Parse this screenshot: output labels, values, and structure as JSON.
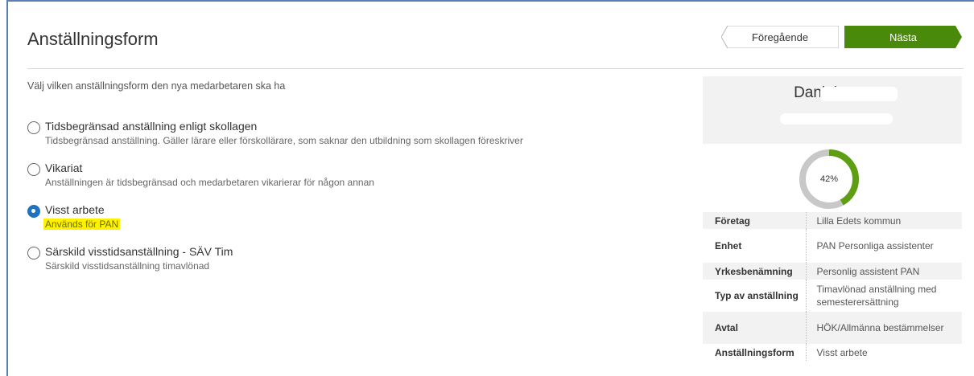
{
  "header": {
    "title": "Anställningsform",
    "prev_label": "Föregående",
    "next_label": "Nästa"
  },
  "instruction": "Välj vilken anställningsform den nya medarbetaren ska ha",
  "options": [
    {
      "title": "Tidsbegränsad anställning enligt skollagen",
      "desc": "Tidsbegränsad anställning. Gäller lärare eller förskollärare, som saknar den utbildning som skollagen föreskriver",
      "selected": false
    },
    {
      "title": "Vikariat",
      "desc": "Anställningen är tidsbegränsad och medarbetaren vikarierar för någon annan",
      "selected": false
    },
    {
      "title": "Visst arbete",
      "desc": "Används för PAN",
      "selected": true
    },
    {
      "title": "Särskild visstidsanställning - SÄV Tim",
      "desc": "Särskild visstidsanställning timavlönad",
      "selected": false
    }
  ],
  "panel": {
    "name": "Daniel",
    "progress_label": "42%",
    "progress_value": 0.42,
    "rows": [
      {
        "key": "Företag",
        "value": "Lilla Edets kommun"
      },
      {
        "key": "Enhet",
        "value": "PAN Personliga assistenter"
      },
      {
        "key": "Yrkesbenämning",
        "value": "Personlig assistent PAN"
      },
      {
        "key": "Typ av anställning",
        "value": "Timavlönad anställning med semesterersättning"
      },
      {
        "key": "Avtal",
        "value": "HÖK/Allmänna bestämmelser"
      },
      {
        "key": "Anställningsform",
        "value": "Visst arbete"
      }
    ]
  },
  "colors": {
    "accent_green": "#4a8a0a",
    "progress_green": "#5e9e12",
    "progress_track": "#c8c8c8",
    "radio_blue": "#1e73be",
    "highlight_yellow": "#fff200"
  }
}
